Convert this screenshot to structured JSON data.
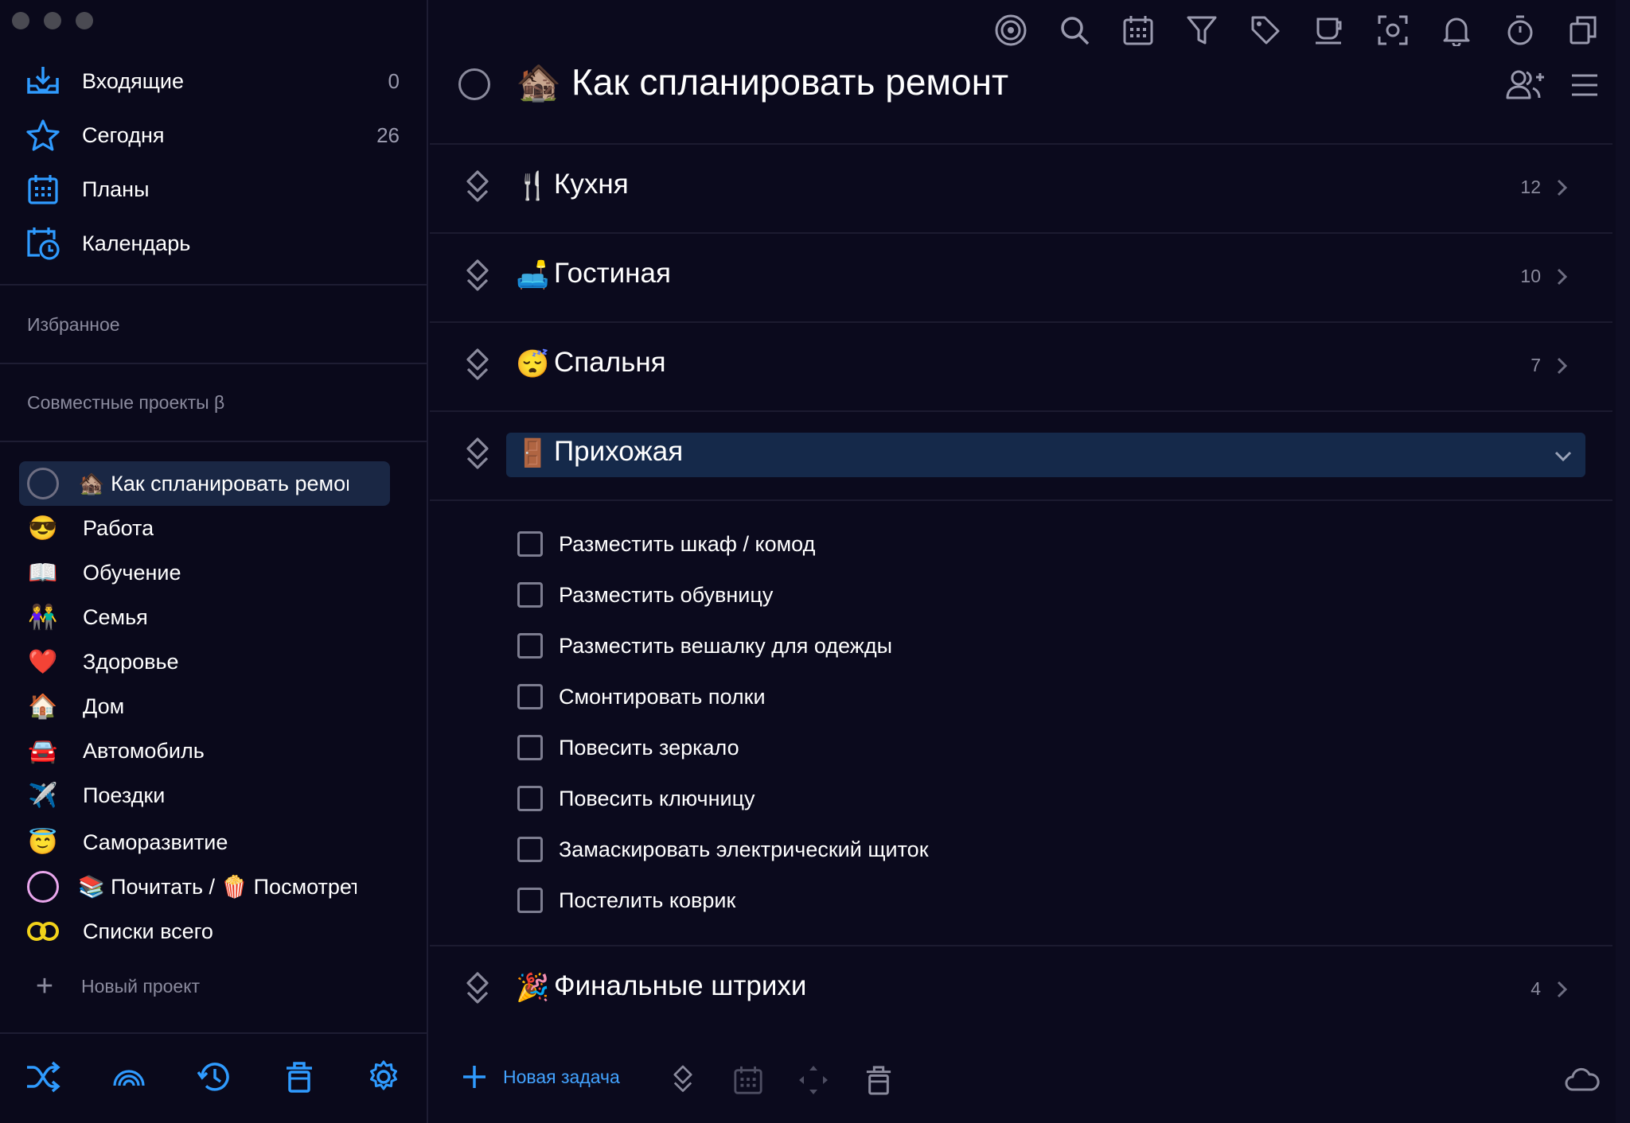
{
  "colors": {
    "accent": "#2f9bff",
    "bg": "#0b0a1d",
    "expanded_heading": "#15294a"
  },
  "sidebar": {
    "nav": [
      {
        "label": "Входящие",
        "count": "0",
        "icon": "inbox-icon"
      },
      {
        "label": "Сегодня",
        "count": "26",
        "icon": "star-icon"
      },
      {
        "label": "Планы",
        "count": "",
        "icon": "calendar-grid-icon"
      },
      {
        "label": "Календарь",
        "count": "",
        "icon": "calendar-clock-icon"
      }
    ],
    "favorites_title": "Избранное",
    "shared_title": "Совместные проекты β",
    "projects": [
      {
        "emoji": "🏚️",
        "label": "🏚️ Как спланировать ремонт",
        "icon": "progress-ring-icon",
        "active": true
      },
      {
        "emoji": "😎",
        "label": "Работа"
      },
      {
        "emoji": "📖",
        "label": "Обучение"
      },
      {
        "emoji": "👫",
        "label": "Семья"
      },
      {
        "emoji": "❤️",
        "label": "Здоровье"
      },
      {
        "emoji": "🏠",
        "label": "Дом"
      },
      {
        "emoji": "🚘",
        "label": "Автомобиль"
      },
      {
        "emoji": "✈️",
        "label": "Поездки"
      },
      {
        "emoji": "😇",
        "label": "Саморазвитие"
      },
      {
        "emoji": "",
        "label": "📚 Почитать / 🍿 Посмотреть",
        "icon": "pink-ring-icon"
      },
      {
        "emoji": "",
        "label": "Списки всего",
        "icon": "infinity-rings-icon"
      }
    ],
    "new_project": "Новый проект",
    "bottom_icons": [
      "shuffle-icon",
      "rainbow-icon",
      "history-icon",
      "trash-icon",
      "gear-icon"
    ]
  },
  "toolbar_icons": [
    "focus-icon",
    "search-icon",
    "calendar-icon",
    "filter-icon",
    "tag-icon",
    "coffee-icon",
    "screenshot-icon",
    "bell-icon",
    "timer-icon",
    "windows-icon"
  ],
  "project": {
    "title": "🏚️ Как спланировать ремонт",
    "headings": [
      {
        "emoji": "🍴",
        "name": "Кухня",
        "count": "12"
      },
      {
        "emoji": "🛋️",
        "name": "Гостиная",
        "count": "10"
      },
      {
        "emoji": "😴",
        "name": "Спальня",
        "count": "7"
      },
      {
        "emoji": "🚪",
        "name": "Прихожая",
        "count": "",
        "expanded": true
      },
      {
        "emoji": "🎉",
        "name": "Финальные штрихи",
        "count": "4"
      }
    ],
    "tasks": [
      "Разместить шкаф / комод",
      "Разместить обувницу",
      "Разместить вешалку для одежды",
      "Смонтировать полки",
      "Повесить зеркало",
      "Повесить ключницу",
      "Замаскировать электрический щиток",
      "Постелить коврик"
    ]
  },
  "footer": {
    "new_task": "Новая задача"
  }
}
